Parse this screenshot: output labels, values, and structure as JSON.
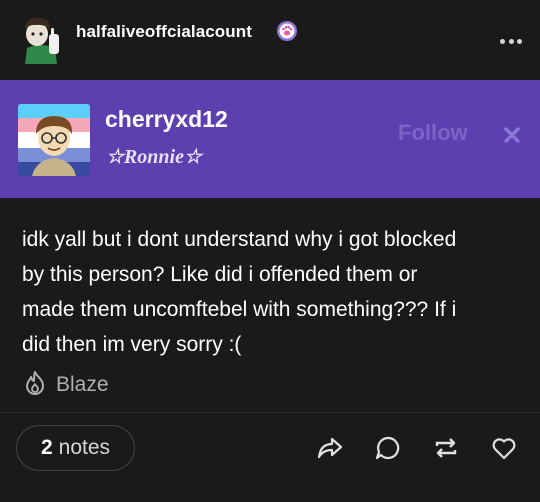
{
  "post": {
    "username": "halfaliveoffcialacount",
    "badge_icon": "paw-badge-icon",
    "more_icon": "more-horizontal-icon"
  },
  "blocked_banner": {
    "username": "cherryxd12",
    "title": "☆Ronnie☆",
    "follow_label": "Follow",
    "dismiss_icon": "close-icon",
    "background": "#5d3fb0"
  },
  "body": {
    "lines": [
      "idk yall but i dont understand why i got blocked",
      "by this person? Like did i offended them or",
      "made them uncomftebel with something??? If i",
      "did then im very sorry :("
    ]
  },
  "blaze": {
    "label": "Blaze",
    "icon": "flame-icon"
  },
  "footer": {
    "notes_count": "2",
    "notes_label": "notes",
    "actions": [
      "share-icon",
      "reply-icon",
      "reblog-icon",
      "like-icon"
    ]
  },
  "colors": {
    "background": "#1a1a1a",
    "text": "#ffffff",
    "muted": "#b0b0b0",
    "accent": "#5d3fb0",
    "follow": "#7a64c7"
  }
}
